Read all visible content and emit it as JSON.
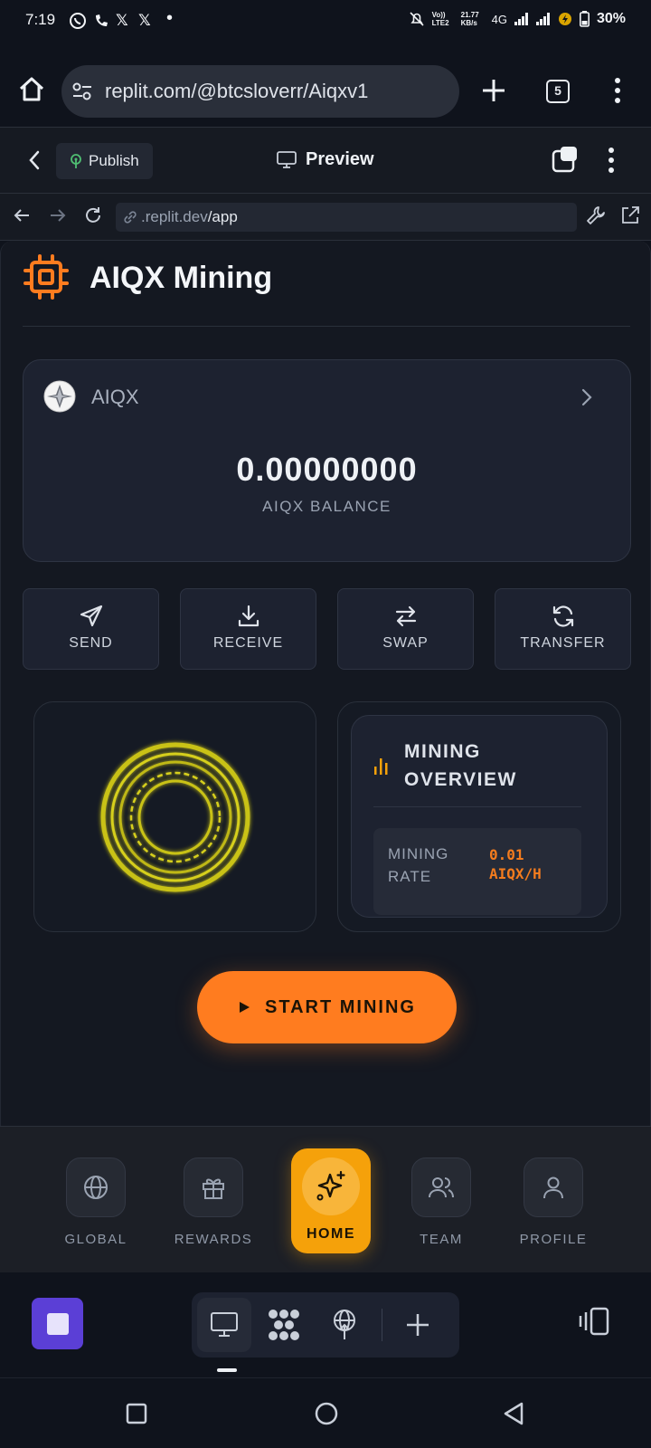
{
  "status_bar": {
    "time": "7:19",
    "network_line1": "Vo)) LTE2",
    "speed": "21.77 KB/s",
    "network_type": "4G",
    "battery": "30%"
  },
  "browser": {
    "url": "replit.com/@btcsloverr/Aiqxv1",
    "tab_count": "5"
  },
  "replit_header": {
    "publish_label": "Publish",
    "preview_label": "Preview"
  },
  "inner_nav": {
    "url_prefix": ".replit.dev",
    "url_path": "/app"
  },
  "app": {
    "title": "AIQX Mining",
    "balance_card": {
      "coin_name": "AIQX",
      "balance": "0.00000000",
      "balance_label": "AIQX BALANCE"
    },
    "actions": [
      {
        "label": "SEND"
      },
      {
        "label": "RECEIVE"
      },
      {
        "label": "SWAP"
      },
      {
        "label": "TRANSFER"
      }
    ],
    "overview": {
      "title_line1": "MINING",
      "title_line2": "OVERVIEW",
      "rate_label": "MINING RATE",
      "rate_value": "0.01 AIQX/H"
    },
    "start_button": "START MINING",
    "accent_orange": "#ff7c1f",
    "accent_yellow": "#f5a10a"
  },
  "bottom_nav": [
    {
      "label": "GLOBAL",
      "icon": "globe-icon"
    },
    {
      "label": "REWARDS",
      "icon": "gift-icon"
    },
    {
      "label": "HOME",
      "icon": "sparkle-icon",
      "active": true
    },
    {
      "label": "TEAM",
      "icon": "users-icon"
    },
    {
      "label": "PROFILE",
      "icon": "user-icon"
    }
  ]
}
